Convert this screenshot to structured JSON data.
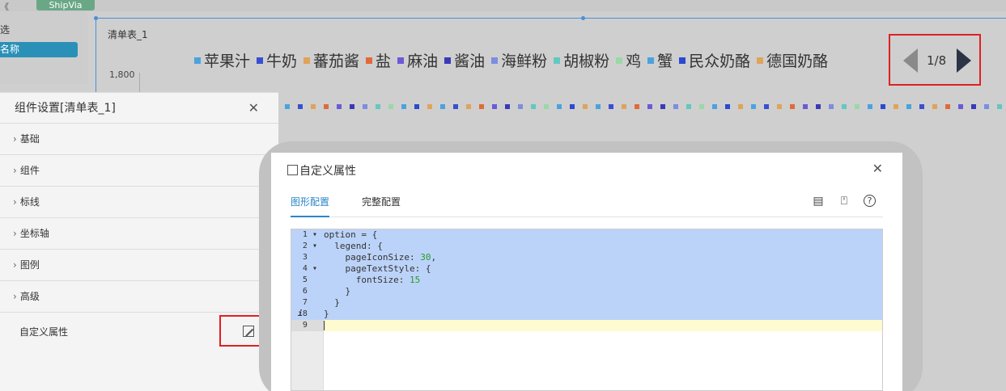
{
  "top": {
    "left_tag": "《",
    "shipvia_tag": "ShipVia",
    "left_label": "选",
    "left_pill": "名称"
  },
  "chart": {
    "title": "清单表_1",
    "y_tick": "1,800",
    "pager_text": "1/8",
    "legend_colors": [
      "#4aa3df",
      "#3a4fd0",
      "#e0a35a",
      "#e06a3a",
      "#6b5ad8",
      "#3a3ab8",
      "#7b8ee0",
      "#62c8c0",
      "#9ad8a8",
      "#4aa3df",
      "#2a4ad0",
      "#e0a35a"
    ]
  },
  "chart_data": {
    "type": "bar",
    "title": "清单表_1",
    "legend": [
      "苹果汁",
      "牛奶",
      "蕃茄酱",
      "盐",
      "麻油",
      "酱油",
      "海鲜粉",
      "胡椒粉",
      "鸡",
      "蟹",
      "民众奶酪",
      "德国奶酪"
    ],
    "yticks": [
      "1,800"
    ],
    "legend_page": "1/8"
  },
  "settings": {
    "title": "组件设置[清单表_1]",
    "rows": [
      "基础",
      "组件",
      "标线",
      "坐标轴",
      "图例",
      "高级"
    ],
    "custom_label": "自定义属性"
  },
  "dialog": {
    "title": "自定义属性",
    "tab_graphic": "图形配置",
    "tab_full": "完整配置",
    "gutter": [
      "1",
      "2",
      "3",
      "4",
      "5",
      "6",
      "7",
      "8",
      "9"
    ]
  },
  "code": {
    "l1": "option = {",
    "l2": "  legend: {",
    "l3_a": "    pageIconSize: ",
    "l3_n": "30",
    "l3_b": ",",
    "l4": "    pageTextStyle: {",
    "l5_a": "      fontSize: ",
    "l5_n": "15",
    "l6": "    }",
    "l7": "  }",
    "l8": "}"
  },
  "colors": {
    "accent": "#2a86c9",
    "highlight_red": "#e02020",
    "selection": "#bcd3f9"
  }
}
